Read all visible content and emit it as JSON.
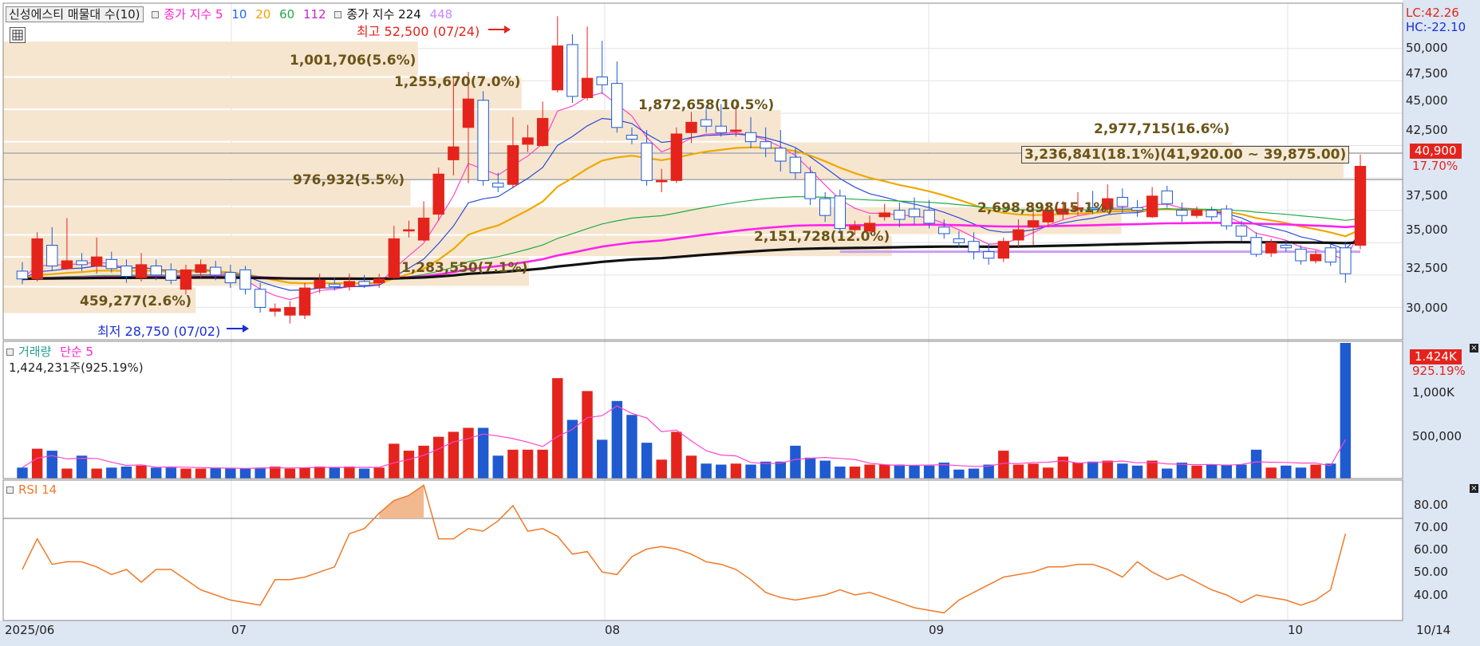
{
  "legend": {
    "name": "신성에스티 매물대 수(10)",
    "ma_label": "종가 지수 5",
    "ma_periods": [
      "10",
      "20",
      "60",
      "112"
    ],
    "ma_colors": [
      "#ff22cc",
      "#2266ff",
      "#f0a000",
      "#22aa44",
      "#cc22cc"
    ],
    "ma2_label": "종가 지수 224",
    "ma2_extra": "448",
    "lc": "LC:42.26",
    "hc": "HC:-22.10"
  },
  "price_axis": [
    "50,000",
    "47,500",
    "45,000",
    "42,500",
    "37,500",
    "35,000",
    "32,500",
    "30,000"
  ],
  "current_price": "40,900",
  "current_change": "17.70%",
  "annotations": {
    "high": "최고 52,500 (07/24)",
    "low": "최저 28,750 (07/02)"
  },
  "volume_profile": [
    {
      "label": "1,001,706(5.6%)"
    },
    {
      "label": "1,255,670(7.0%)"
    },
    {
      "label": "1,872,658(10.5%)"
    },
    {
      "label": "2,977,715(16.6%)"
    },
    {
      "label": "3,236,841(18.1%)(41,920.00 ~ 39,875.00)"
    },
    {
      "label": "976,932(5.5%)"
    },
    {
      "label": "2,698,898(15.1%)"
    },
    {
      "label": "2,151,728(12.0%)"
    },
    {
      "label": "1,283,550(7.1%)"
    },
    {
      "label": "459,277(2.6%)"
    }
  ],
  "volume_panel": {
    "title": "거래량",
    "ma_label": "단순 5",
    "value": "1,424,231주(925.19%)",
    "axis": [
      "1,000K",
      "500,000"
    ],
    "badge": "1.424K",
    "badge_pct": "925.19%"
  },
  "rsi_panel": {
    "title": "RSI 14",
    "axis": [
      "80.00",
      "70.00",
      "60.00",
      "50.00",
      "40.00"
    ]
  },
  "x_axis": [
    "2025/06",
    "07",
    "08",
    "09",
    "10",
    "10/14"
  ],
  "chart_data": {
    "type": "candlestick",
    "price_ylim": [
      27500,
      53500
    ],
    "candles": [
      {
        "o": 32800,
        "c": 32200,
        "h": 33500,
        "l": 31800
      },
      {
        "o": 32200,
        "c": 35300,
        "h": 35800,
        "l": 32000
      },
      {
        "o": 34800,
        "c": 33200,
        "h": 36200,
        "l": 32800
      },
      {
        "o": 33000,
        "c": 33600,
        "h": 36900,
        "l": 32900
      },
      {
        "o": 33600,
        "c": 33300,
        "h": 34200,
        "l": 32800
      },
      {
        "o": 33200,
        "c": 33900,
        "h": 35400,
        "l": 32600
      },
      {
        "o": 33700,
        "c": 33000,
        "h": 34300,
        "l": 32700
      },
      {
        "o": 33200,
        "c": 32400,
        "h": 33700,
        "l": 31900
      },
      {
        "o": 32300,
        "c": 33300,
        "h": 34200,
        "l": 32000
      },
      {
        "o": 33200,
        "c": 32500,
        "h": 33700,
        "l": 32100
      },
      {
        "o": 32900,
        "c": 32100,
        "h": 33400,
        "l": 31800
      },
      {
        "o": 31400,
        "c": 32900,
        "h": 33300,
        "l": 31000
      },
      {
        "o": 32700,
        "c": 33300,
        "h": 33700,
        "l": 32300
      },
      {
        "o": 33100,
        "c": 32500,
        "h": 33600,
        "l": 32100
      },
      {
        "o": 32700,
        "c": 31900,
        "h": 33300,
        "l": 31500
      },
      {
        "o": 32900,
        "c": 31400,
        "h": 33200,
        "l": 31000
      },
      {
        "o": 31400,
        "c": 30000,
        "h": 31900,
        "l": 29600
      },
      {
        "o": 29700,
        "c": 29900,
        "h": 30300,
        "l": 29300
      },
      {
        "o": 29400,
        "c": 30000,
        "h": 30500,
        "l": 28750
      },
      {
        "o": 29400,
        "c": 31500,
        "h": 31900,
        "l": 29100
      },
      {
        "o": 31500,
        "c": 32100,
        "h": 32600,
        "l": 31100
      },
      {
        "o": 31800,
        "c": 31600,
        "h": 32300,
        "l": 31300
      },
      {
        "o": 31600,
        "c": 32000,
        "h": 32600,
        "l": 31300
      },
      {
        "o": 32000,
        "c": 31700,
        "h": 32500,
        "l": 31500
      },
      {
        "o": 31900,
        "c": 32200,
        "h": 32600,
        "l": 31500
      },
      {
        "o": 32300,
        "c": 35300,
        "h": 36300,
        "l": 32200
      },
      {
        "o": 35900,
        "c": 36000,
        "h": 36700,
        "l": 35400
      },
      {
        "o": 35200,
        "c": 36900,
        "h": 38200,
        "l": 35100
      },
      {
        "o": 37200,
        "c": 40300,
        "h": 40800,
        "l": 36700
      },
      {
        "o": 41400,
        "c": 42400,
        "h": 47800,
        "l": 40200
      },
      {
        "o": 43900,
        "c": 46100,
        "h": 48200,
        "l": 39600
      },
      {
        "o": 46000,
        "c": 39800,
        "h": 46700,
        "l": 39400
      },
      {
        "o": 39600,
        "c": 39300,
        "h": 40400,
        "l": 38900
      },
      {
        "o": 39500,
        "c": 42500,
        "h": 44700,
        "l": 39200
      },
      {
        "o": 42600,
        "c": 43100,
        "h": 44100,
        "l": 42000
      },
      {
        "o": 42500,
        "c": 44600,
        "h": 45900,
        "l": 42400
      },
      {
        "o": 46800,
        "c": 50200,
        "h": 52500,
        "l": 46600
      },
      {
        "o": 50300,
        "c": 46300,
        "h": 51100,
        "l": 45800
      },
      {
        "o": 46200,
        "c": 47700,
        "h": 51700,
        "l": 46000
      },
      {
        "o": 47800,
        "c": 47200,
        "h": 50600,
        "l": 46500
      },
      {
        "o": 47300,
        "c": 43900,
        "h": 49000,
        "l": 43500
      },
      {
        "o": 43300,
        "c": 43000,
        "h": 43900,
        "l": 42600
      },
      {
        "o": 42700,
        "c": 39800,
        "h": 43700,
        "l": 39400
      },
      {
        "o": 39700,
        "c": 39800,
        "h": 40700,
        "l": 38900
      },
      {
        "o": 39800,
        "c": 43400,
        "h": 43900,
        "l": 39600
      },
      {
        "o": 43500,
        "c": 44300,
        "h": 45100,
        "l": 42700
      },
      {
        "o": 44500,
        "c": 44000,
        "h": 45500,
        "l": 43500
      },
      {
        "o": 44000,
        "c": 43500,
        "h": 45700,
        "l": 43200
      },
      {
        "o": 43600,
        "c": 43700,
        "h": 45600,
        "l": 43200
      },
      {
        "o": 43500,
        "c": 42800,
        "h": 44700,
        "l": 42300
      },
      {
        "o": 42800,
        "c": 42300,
        "h": 43900,
        "l": 41600
      },
      {
        "o": 42300,
        "c": 41300,
        "h": 43700,
        "l": 40500
      },
      {
        "o": 41600,
        "c": 40400,
        "h": 42300,
        "l": 39900
      },
      {
        "o": 40400,
        "c": 38400,
        "h": 40900,
        "l": 37900
      },
      {
        "o": 38400,
        "c": 37100,
        "h": 38900,
        "l": 36600
      },
      {
        "o": 38600,
        "c": 36100,
        "h": 39100,
        "l": 35700
      },
      {
        "o": 36000,
        "c": 36300,
        "h": 36700,
        "l": 35600
      },
      {
        "o": 35900,
        "c": 36500,
        "h": 37100,
        "l": 35700
      },
      {
        "o": 37000,
        "c": 37300,
        "h": 38000,
        "l": 36700
      },
      {
        "o": 37500,
        "c": 36800,
        "h": 38100,
        "l": 36200
      },
      {
        "o": 37600,
        "c": 37000,
        "h": 38500,
        "l": 36400
      },
      {
        "o": 37500,
        "c": 36500,
        "h": 38300,
        "l": 36100
      },
      {
        "o": 36200,
        "c": 35700,
        "h": 36800,
        "l": 35300
      },
      {
        "o": 35300,
        "c": 35000,
        "h": 35900,
        "l": 34600
      },
      {
        "o": 35100,
        "c": 34300,
        "h": 35800,
        "l": 33700
      },
      {
        "o": 34300,
        "c": 33800,
        "h": 34900,
        "l": 33300
      },
      {
        "o": 33800,
        "c": 35100,
        "h": 35400,
        "l": 33500
      },
      {
        "o": 35200,
        "c": 36000,
        "h": 36800,
        "l": 34700
      },
      {
        "o": 36200,
        "c": 36700,
        "h": 37900,
        "l": 34800
      },
      {
        "o": 36600,
        "c": 37500,
        "h": 38100,
        "l": 36200
      },
      {
        "o": 37200,
        "c": 37600,
        "h": 38200,
        "l": 36800
      },
      {
        "o": 37600,
        "c": 37700,
        "h": 38900,
        "l": 37100
      },
      {
        "o": 37700,
        "c": 37600,
        "h": 39000,
        "l": 37200
      },
      {
        "o": 37600,
        "c": 38400,
        "h": 39500,
        "l": 37300
      },
      {
        "o": 38500,
        "c": 37800,
        "h": 39200,
        "l": 37300
      },
      {
        "o": 37700,
        "c": 37500,
        "h": 38300,
        "l": 37000
      },
      {
        "o": 37000,
        "c": 38600,
        "h": 39300,
        "l": 36900
      },
      {
        "o": 39000,
        "c": 38000,
        "h": 39400,
        "l": 37700
      },
      {
        "o": 37500,
        "c": 37100,
        "h": 38100,
        "l": 36600
      },
      {
        "o": 37100,
        "c": 37500,
        "h": 37800,
        "l": 36900
      },
      {
        "o": 37500,
        "c": 37000,
        "h": 37800,
        "l": 36700
      },
      {
        "o": 37600,
        "c": 36300,
        "h": 37900,
        "l": 36000
      },
      {
        "o": 36300,
        "c": 35500,
        "h": 36700,
        "l": 35100
      },
      {
        "o": 35400,
        "c": 34100,
        "h": 35800,
        "l": 33900
      },
      {
        "o": 34200,
        "c": 35000,
        "h": 35300,
        "l": 33900
      },
      {
        "o": 34800,
        "c": 34600,
        "h": 35200,
        "l": 34300
      },
      {
        "o": 34500,
        "c": 33600,
        "h": 34800,
        "l": 33300
      },
      {
        "o": 33600,
        "c": 34100,
        "h": 34400,
        "l": 33400
      },
      {
        "o": 34600,
        "c": 33500,
        "h": 34900,
        "l": 33200
      },
      {
        "o": 34600,
        "c": 32600,
        "h": 35100,
        "l": 31900
      },
      {
        "o": 34800,
        "c": 40900,
        "h": 41800,
        "l": 34500
      }
    ],
    "volume": [
      110000,
      300000,
      280000,
      100000,
      230000,
      100000,
      110000,
      120000,
      130000,
      110000,
      110000,
      100000,
      100000,
      110000,
      100000,
      100000,
      110000,
      120000,
      100000,
      110000,
      120000,
      110000,
      120000,
      100000,
      110000,
      350000,
      280000,
      330000,
      420000,
      470000,
      510000,
      510000,
      230000,
      290000,
      290000,
      290000,
      1010000,
      590000,
      880000,
      390000,
      780000,
      640000,
      360000,
      190000,
      470000,
      230000,
      150000,
      140000,
      150000,
      140000,
      170000,
      170000,
      330000,
      210000,
      180000,
      120000,
      120000,
      140000,
      140000,
      140000,
      130000,
      130000,
      160000,
      90000,
      100000,
      140000,
      280000,
      140000,
      150000,
      110000,
      220000,
      160000,
      170000,
      180000,
      150000,
      130000,
      180000,
      100000,
      160000,
      130000,
      140000,
      140000,
      140000,
      290000,
      110000,
      130000,
      110000,
      140000,
      150000,
      1424231
    ],
    "volume_ylim": [
      0,
      1300000
    ],
    "rsi": [
      50,
      62,
      52,
      53,
      53,
      51,
      48,
      50,
      45,
      50,
      50,
      46,
      42,
      40,
      38,
      37,
      36,
      46,
      46,
      47,
      49,
      51,
      64,
      66,
      72,
      77,
      79,
      83,
      62,
      62,
      66,
      65,
      69,
      75,
      65,
      66,
      63,
      56,
      57,
      49,
      48,
      55,
      58,
      59,
      58,
      56,
      53,
      52,
      50,
      46,
      41,
      39,
      38,
      39,
      40,
      42,
      40,
      41,
      39,
      37,
      35,
      34,
      33,
      38,
      41,
      44,
      47,
      48,
      49,
      51,
      51,
      52,
      52,
      50,
      47,
      53,
      49,
      46,
      48,
      45,
      42,
      40,
      37,
      40,
      39,
      38,
      36,
      38,
      42,
      64
    ],
    "rsi_ylim": [
      30,
      85
    ]
  }
}
